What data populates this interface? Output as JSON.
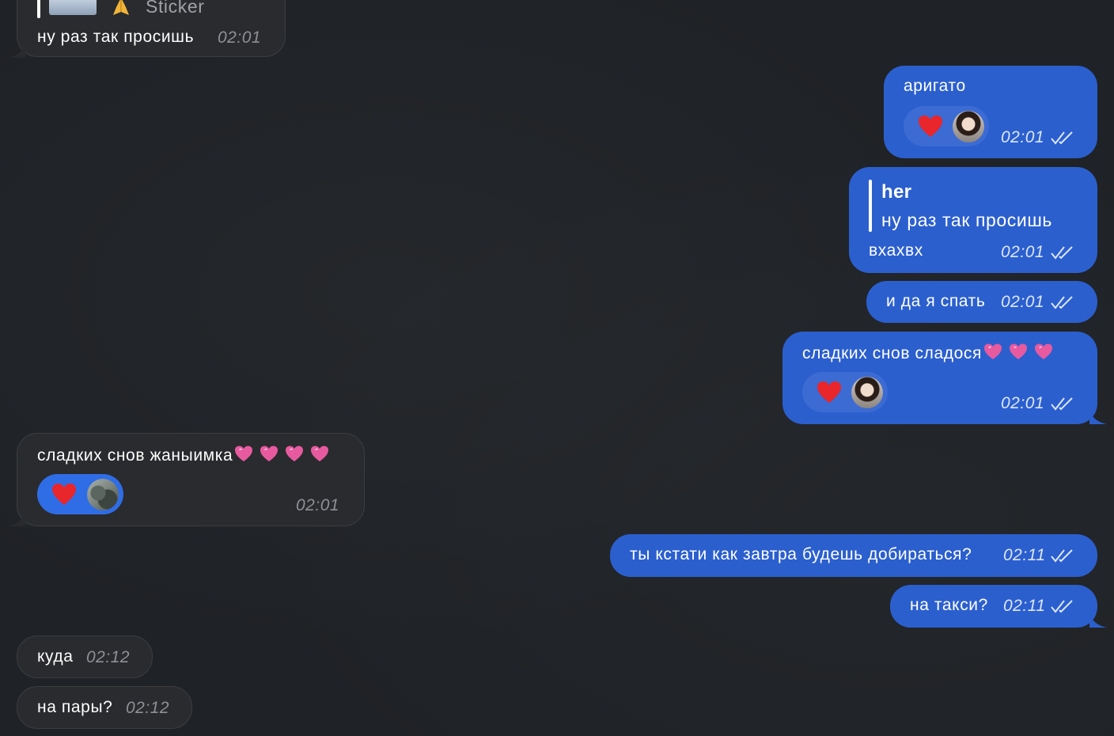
{
  "messages": [
    {
      "id": "m1",
      "dir": "in",
      "reply_preview_label": "Sticker",
      "text": "ну раз так просишь",
      "time": "02:01"
    },
    {
      "id": "m2",
      "dir": "out",
      "text": "аригато",
      "time": "02:01",
      "reaction": "heart",
      "read": true
    },
    {
      "id": "m3",
      "dir": "out",
      "reply_author": "her",
      "reply_text": "ну раз так просишь",
      "text": "вхахвх",
      "time": "02:01",
      "read": true
    },
    {
      "id": "m4",
      "dir": "out",
      "text": "и да я спать",
      "time": "02:01",
      "read": true
    },
    {
      "id": "m5",
      "dir": "out",
      "text": "сладких снов сладося",
      "emoji_count": 3,
      "time": "02:01",
      "reaction": "heart",
      "read": true
    },
    {
      "id": "m6",
      "dir": "in",
      "text": "сладких снов жаныимка",
      "emoji_count": 4,
      "time": "02:01",
      "reaction": "heart"
    },
    {
      "id": "m7",
      "dir": "out",
      "text": "ты кстати как завтра будешь добираться?",
      "time": "02:11",
      "read": true
    },
    {
      "id": "m8",
      "dir": "out",
      "text": "на такси?",
      "time": "02:11",
      "read": true
    },
    {
      "id": "m9",
      "dir": "in",
      "text": "куда",
      "time": "02:12"
    },
    {
      "id": "m10",
      "dir": "in",
      "text": "на пары?",
      "time": "02:12"
    }
  ],
  "icons": {
    "reaction": "red-heart-emoji",
    "message_emoji": "pink-heart-emoji",
    "read_status": "double-check-icon",
    "reply_sticker": "folded-hands-emoji"
  },
  "colors": {
    "background": "#1f2226",
    "incoming_bubble": "#2a2b2e",
    "outgoing_bubble": "#2b5fce",
    "reaction_heart": "#e8262b",
    "message_heart": "#e85aa0"
  }
}
